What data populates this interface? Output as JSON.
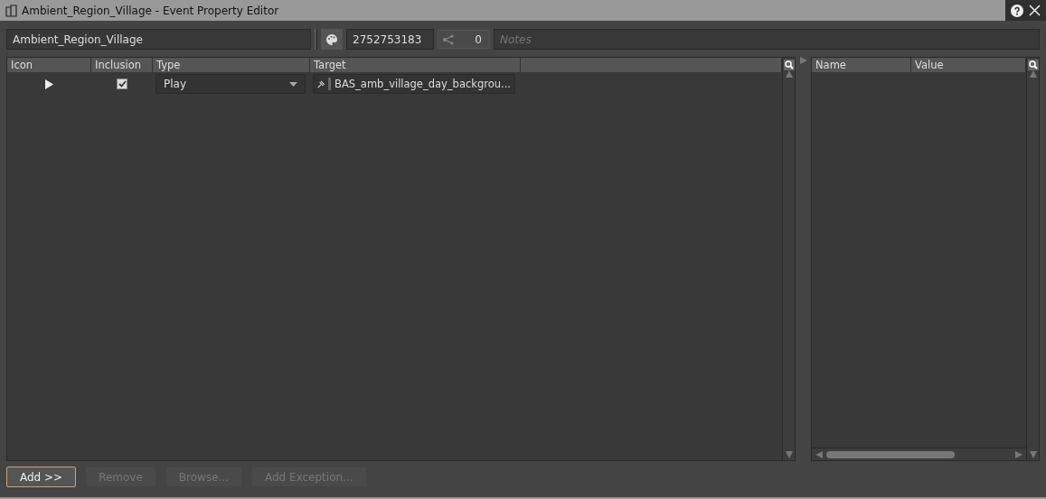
{
  "window": {
    "title": "Ambient_Region_Village - Event Property Editor"
  },
  "header": {
    "name": "Ambient_Region_Village",
    "id": "2752753183",
    "references": "0",
    "notes_placeholder": "Notes"
  },
  "actions_table": {
    "columns": [
      "Icon",
      "Inclusion",
      "Type",
      "Target"
    ],
    "rows": [
      {
        "included": true,
        "type": "Play",
        "target": "BAS_amb_village_day_backgrou..."
      }
    ]
  },
  "properties_table": {
    "columns": [
      "Name",
      "Value"
    ]
  },
  "buttons": [
    {
      "label": "Add >>",
      "disabled": false
    },
    {
      "label": "Remove",
      "disabled": true
    },
    {
      "label": "Browse...",
      "disabled": true
    },
    {
      "label": "Add Exception...",
      "disabled": true
    }
  ]
}
